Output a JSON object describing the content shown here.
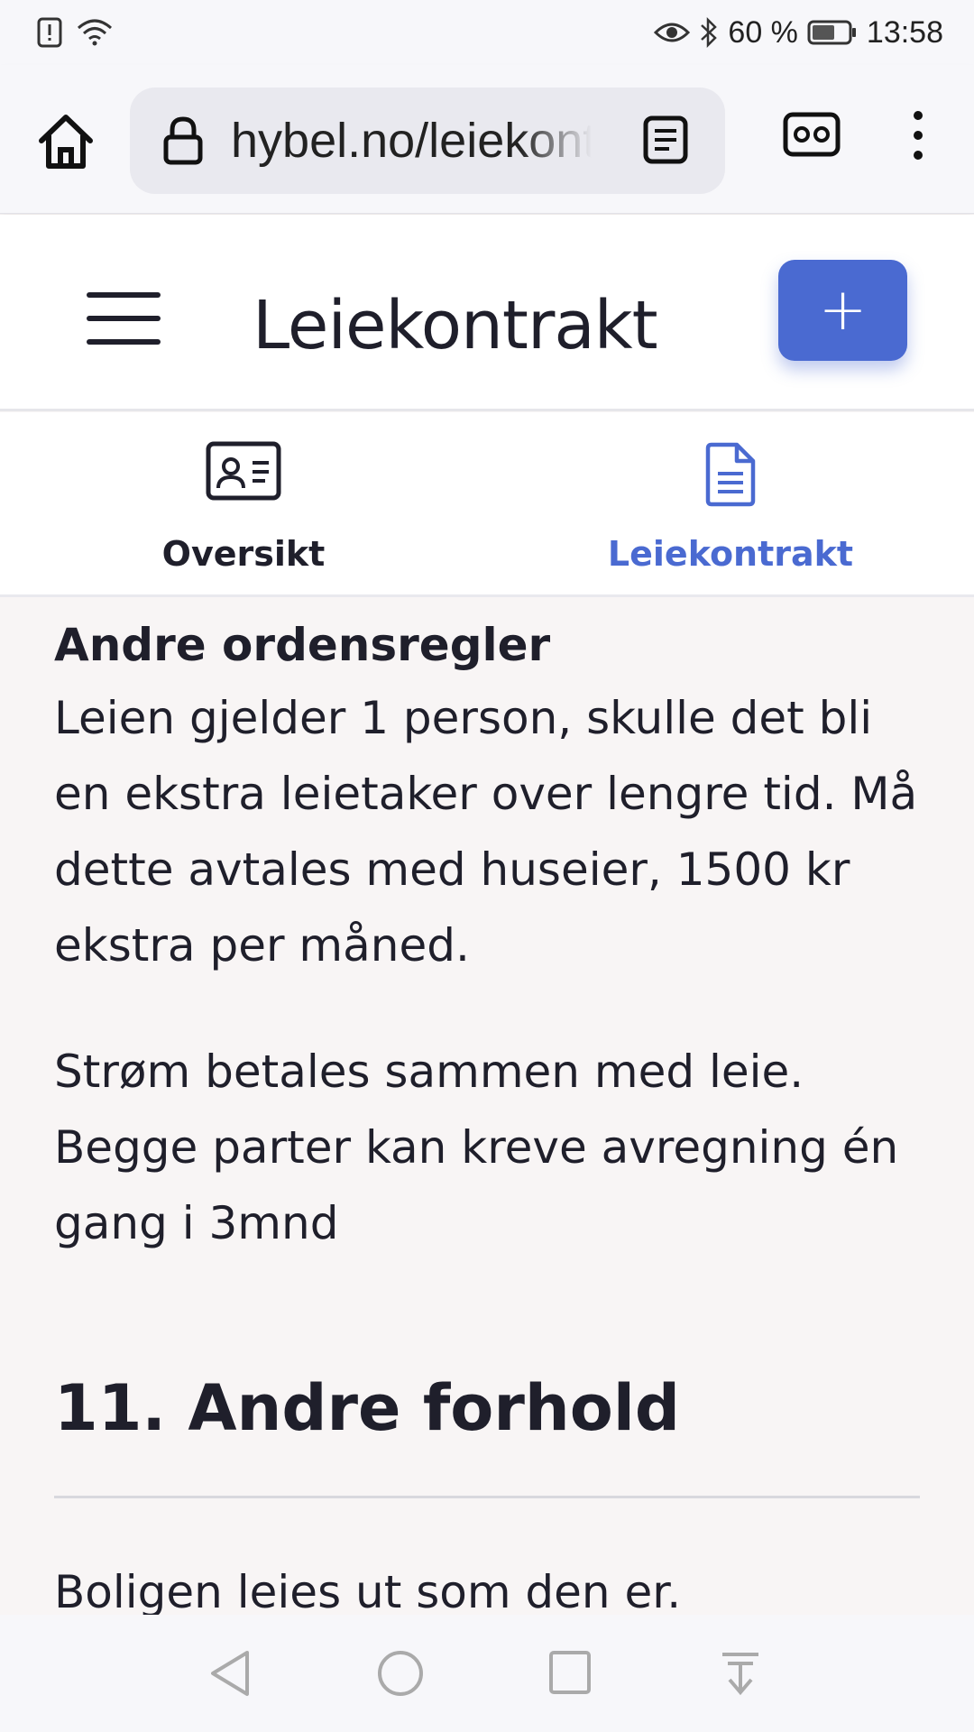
{
  "status_bar": {
    "battery_percent": "60 %",
    "time": "13:58",
    "icons": [
      "alert-icon",
      "wifi-icon",
      "eye-icon",
      "bluetooth-icon",
      "battery-icon"
    ]
  },
  "browser": {
    "url": "hybel.no/leiekontrakt",
    "icons": [
      "home-icon",
      "lock-icon",
      "reader-mode-icon",
      "vr-icon",
      "more-vert-icon"
    ]
  },
  "header": {
    "title": "Leiekontrakt",
    "add_label": "+",
    "accent_color": "#4a6ad1"
  },
  "tabs": [
    {
      "label": "Oversikt",
      "icon": "id-card-icon",
      "active": false
    },
    {
      "label": "Leiekontrakt",
      "icon": "document-icon",
      "active": true
    }
  ],
  "content": {
    "section_heading": "Andre ordensregler",
    "paragraph_1": "Leien gjelder 1 person, skulle det bli en ekstra leietaker over lengre tid. Må dette avtales med huseier, 1500 kr ekstra per måned.",
    "paragraph_2": "Strøm betales sammen med leie. Begge parter kan kreve avregning én gang i 3mnd",
    "chapter_title": "11. Andre forhold",
    "paragraph_3": "Boligen leies ut som den er."
  },
  "nav_bar": {
    "icons": [
      "back-icon",
      "home-circle-icon",
      "recents-icon",
      "notification-pull-icon"
    ]
  }
}
